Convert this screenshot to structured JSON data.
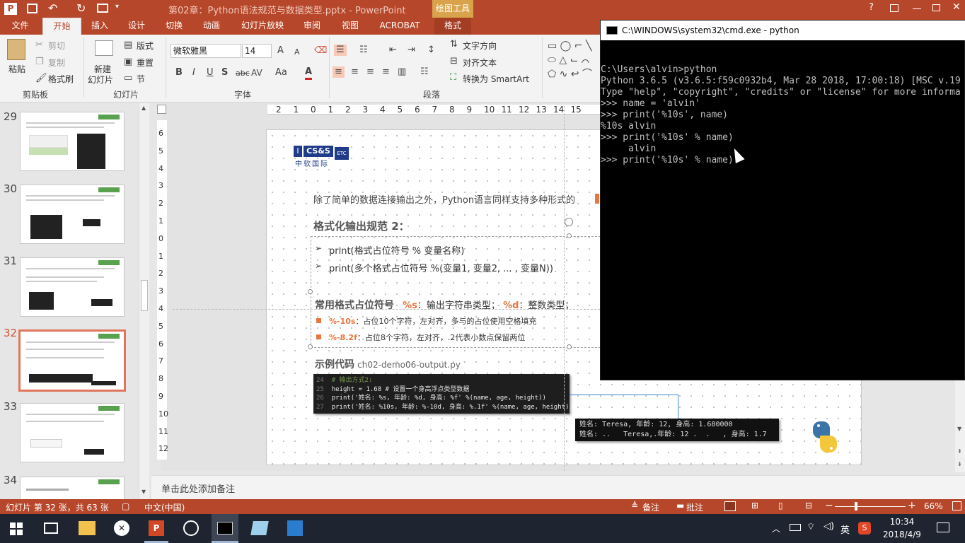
{
  "title_bar": {
    "doc_title": "第02章：Python语法规范与数据类型.pptx - PowerPoint",
    "context_tab": "绘图工具",
    "help": "?",
    "undo": "↶",
    "redo": "↻"
  },
  "tabs": [
    "文件",
    "开始",
    "插入",
    "设计",
    "切换",
    "动画",
    "幻灯片放映",
    "审阅",
    "视图",
    "ACROBAT",
    "格式"
  ],
  "ribbon": {
    "clipboard": {
      "paste": "粘贴",
      "cut": "剪切",
      "copy": "复制",
      "format_painter": "格式刷",
      "group": "剪贴板"
    },
    "slides": {
      "new_slide": "新建",
      "new_slide2": "幻灯片",
      "layout": "版式",
      "reset": "重置",
      "section": "节",
      "group": "幻灯片"
    },
    "font": {
      "name": "微软雅黑",
      "size": "14",
      "bold": "B",
      "italic": "I",
      "underline": "U",
      "shadow": "S",
      "strike": "abc",
      "spacing": "AV",
      "case": "Aa",
      "color": "A",
      "grow": "A",
      "shrink": "A",
      "group": "字体"
    },
    "paragraph": {
      "text_direction": "文字方向",
      "align_text": "对齐文本",
      "smartart": "转换为 SmartArt",
      "group": "段落"
    }
  },
  "thumbs": [
    {
      "num": "29"
    },
    {
      "num": "30"
    },
    {
      "num": "31"
    },
    {
      "num": "32",
      "selected": true
    },
    {
      "num": "33"
    },
    {
      "num": "34"
    }
  ],
  "ruler_top": [
    "2",
    "1",
    "0",
    "1",
    "2",
    "3",
    "4",
    "5",
    "6",
    "7",
    "8",
    "9",
    "10",
    "11",
    "12",
    "13",
    "14",
    "15"
  ],
  "ruler_left": [
    "6",
    "5",
    "4",
    "3",
    "2",
    "1",
    "0",
    "1",
    "2",
    "3",
    "4",
    "5",
    "6",
    "7",
    "8",
    "9",
    "10",
    "11",
    "12"
  ],
  "slide": {
    "logo_text": "CS&S",
    "logo_sub": "中软国际",
    "logo_etc": "ETC",
    "intro": "除了简单的数据连接输出之外，Python语言同样支持多种形式的",
    "spec_title": "格式化输出规范 2：",
    "bullet1": "print(格式占位符号 % 变量名称)",
    "bullet2": "print(多个格式占位符号 %(变量1, 变量2, ... , 变量N))",
    "placeholder_title": "常用格式占位符号",
    "ph_s": "%s",
    "ph_s_desc": "：输出字符串类型；",
    "ph_d": "%d",
    "ph_d_desc": "：整数类型；",
    "ph1_code": "%-10s",
    "ph1_desc": "：占位10个字符，左对齐，多与的占位使用空格填充",
    "ph2_code": "%-8.2f",
    "ph2_desc": "：占位8个字符，左对齐，.2代表小数点保留两位",
    "example_title": "示例代码",
    "example_file": "ch02-demo06-output.py",
    "code_lines": [
      {
        "n": "24",
        "t": "# 输出方式2:"
      },
      {
        "n": "25",
        "t": "height = 1.68 # 设置一个身高浮点类型数据"
      },
      {
        "n": "26",
        "t": "print('姓名: %s, 年龄: %d, 身高: %f' %(name, age, height))"
      },
      {
        "n": "27",
        "t": "print('姓名: %10s, 年龄: %-10d, 身高: %.1f' %(name, age, height))"
      }
    ],
    "output_lines": [
      "姓名: Teresa, 年龄: 12, 身高: 1.680000",
      "姓名: ..   Teresa,.年龄: 12 .  .   , 身高: 1.7"
    ]
  },
  "cmd": {
    "title": "C:\\WINDOWS\\system32\\cmd.exe - python",
    "lines": [
      "C:\\Users\\alvin>python",
      "Python 3.6.5 (v3.6.5:f59c0932b4, Mar 28 2018, 17:00:18) [MSC v.19",
      "Type \"help\", \"copyright\", \"credits\" or \"license\" for more informa",
      ">>> name = 'alvin'",
      ">>> print('%10s', name)",
      "%10s alvin",
      ">>> print('%10s' % name)",
      "     alvin",
      ">>> print('%10s' % name)"
    ]
  },
  "notes": "单击此处添加备注",
  "status": {
    "slide_info": "幻灯片 第 32 张，共 63 张",
    "language": "中文(中国)",
    "notes_btn": "备注",
    "comments_btn": "批注",
    "zoom": "66%"
  },
  "taskbar": {
    "ime": "英",
    "time": "10:34",
    "date": "2018/4/9"
  },
  "colors": {
    "accent": "#b7472a",
    "orange": "#e7763f"
  }
}
